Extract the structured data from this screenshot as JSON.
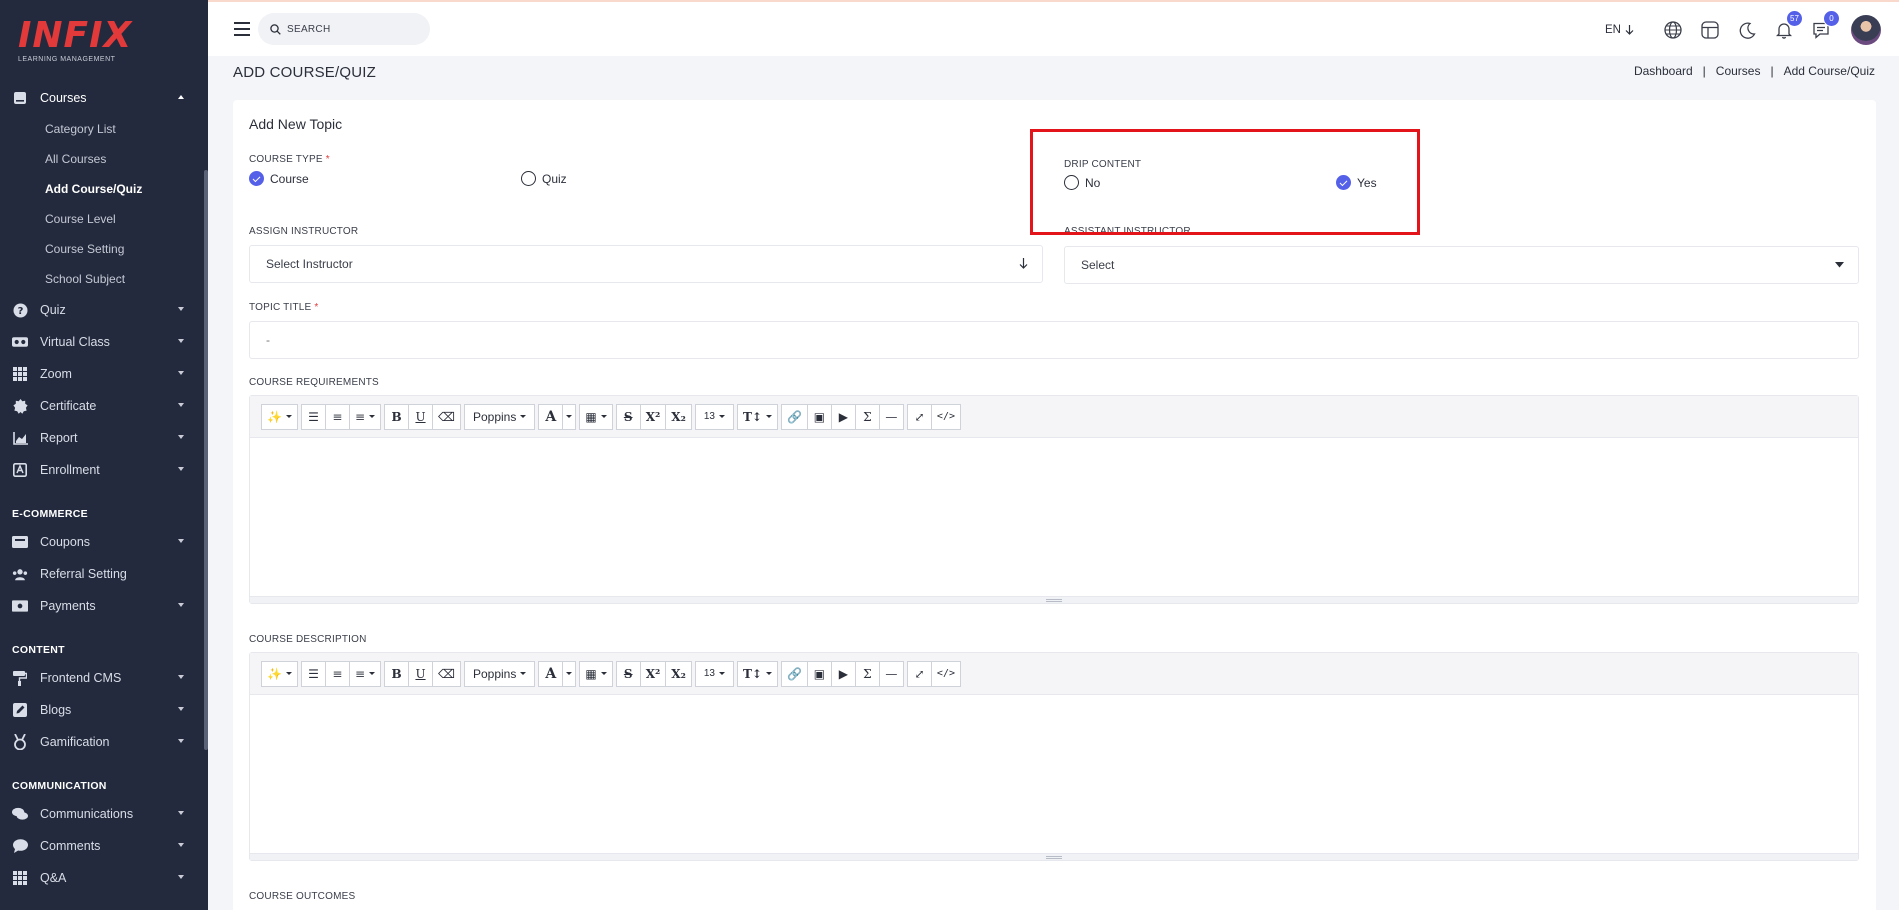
{
  "brand": {
    "logo_text": "INFIX",
    "tagline": "LEARNING MANAGEMENT"
  },
  "sidebar": {
    "courses": {
      "label": "Courses",
      "sub_items": [
        "Category List",
        "All Courses",
        "Add Course/Quiz",
        "Course Level",
        "Course Setting",
        "School Subject"
      ],
      "active_sub": "Add Course/Quiz"
    },
    "items": [
      {
        "label": "Quiz",
        "icon": "help-circle-icon"
      },
      {
        "label": "Virtual Class",
        "icon": "vr-headset-icon"
      },
      {
        "label": "Zoom",
        "icon": "grid-icon"
      },
      {
        "label": "Certificate",
        "icon": "badge-icon"
      },
      {
        "label": "Report",
        "icon": "chart-icon"
      },
      {
        "label": "Enrollment",
        "icon": "enrollment-icon"
      }
    ],
    "sections": {
      "ecommerce": {
        "title": "E-COMMERCE",
        "items": [
          {
            "label": "Coupons",
            "icon": "ticket-icon",
            "has_caret": true
          },
          {
            "label": "Referral Setting",
            "icon": "users-icon",
            "has_caret": false
          },
          {
            "label": "Payments",
            "icon": "money-icon",
            "has_caret": true
          }
        ]
      },
      "content": {
        "title": "CONTENT",
        "items": [
          {
            "label": "Frontend CMS",
            "icon": "paint-roller-icon"
          },
          {
            "label": "Blogs",
            "icon": "edit-icon"
          },
          {
            "label": "Gamification",
            "icon": "medal-icon"
          }
        ]
      },
      "communication": {
        "title": "COMMUNICATION",
        "items": [
          {
            "label": "Communications",
            "icon": "chat-icon"
          },
          {
            "label": "Comments",
            "icon": "comment-icon"
          },
          {
            "label": "Q&A",
            "icon": "grid-icon"
          }
        ]
      }
    }
  },
  "topbar": {
    "search_placeholder": "SEARCH",
    "language": "EN",
    "notifications_count": "57",
    "messages_count": "0"
  },
  "page": {
    "title": "ADD COURSE/QUIZ",
    "breadcrumb": [
      "Dashboard",
      "Courses",
      "Add Course/Quiz"
    ]
  },
  "form": {
    "card_title": "Add New Topic",
    "course_type": {
      "label": "COURSE TYPE",
      "options": [
        "Course",
        "Quiz"
      ],
      "selected": "Course"
    },
    "drip_content": {
      "label": "DRIP CONTENT",
      "options": [
        "No",
        "Yes"
      ],
      "selected": "Yes"
    },
    "assign_instructor": {
      "label": "ASSIGN INSTRUCTOR",
      "placeholder": "Select Instructor"
    },
    "assistant_instructor": {
      "label": "ASSISTANT INSTRUCTOR",
      "value": "Select"
    },
    "topic_title": {
      "label": "TOPIC TITLE",
      "placeholder": "-"
    },
    "course_requirements": {
      "label": "COURSE REQUIREMENTS"
    },
    "course_description": {
      "label": "COURSE DESCRIPTION"
    },
    "course_outcomes": {
      "label": "COURSE OUTCOMES"
    }
  },
  "editor_toolbar": {
    "font_name": "Poppins",
    "font_size": "13"
  },
  "colors": {
    "sidebar": "#232a3d",
    "accent": "#5560e9",
    "highlight": "#e4141b",
    "brand_red": "#e23a3a"
  }
}
